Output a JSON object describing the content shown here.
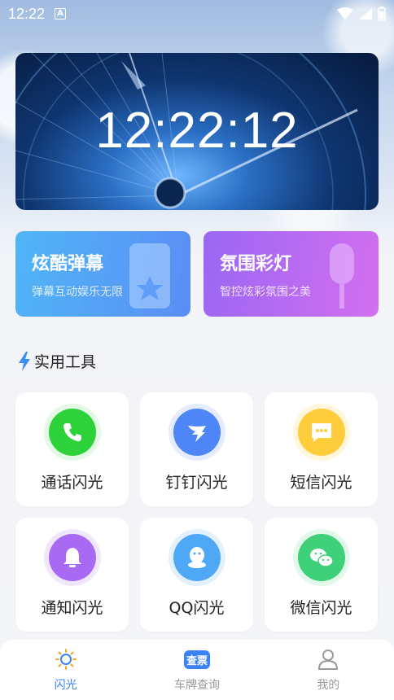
{
  "status_bar": {
    "time": "12:22",
    "notification_icon": "a-icon"
  },
  "clock": {
    "time": "12:22:12"
  },
  "promos": [
    {
      "title": "炫酷弹幕",
      "subtitle": "弹幕互动娱乐无限"
    },
    {
      "title": "氛围彩灯",
      "subtitle": "智控炫彩氛围之美"
    }
  ],
  "section": {
    "title": "实用工具"
  },
  "tools": [
    {
      "label": "通话闪光",
      "icon": "phone-icon",
      "color": "#2dd13a"
    },
    {
      "label": "钉钉闪光",
      "icon": "dingtalk-icon",
      "color": "#4f86f7"
    },
    {
      "label": "短信闪光",
      "icon": "message-icon",
      "color": "#ffcc3c"
    },
    {
      "label": "通知闪光",
      "icon": "bell-icon",
      "color": "#a86af3"
    },
    {
      "label": "QQ闪光",
      "icon": "qq-icon",
      "color": "#4fa8f6"
    },
    {
      "label": "微信闪光",
      "icon": "wechat-icon",
      "color": "#3fd07a"
    }
  ],
  "nav": [
    {
      "label": "闪光",
      "icon": "sun-icon",
      "active": true
    },
    {
      "label": "车牌查询",
      "icon": "plate-query-icon",
      "badge": "查票"
    },
    {
      "label": "我的",
      "icon": "user-icon"
    }
  ],
  "colors": {
    "accent": "#3b82f6"
  }
}
